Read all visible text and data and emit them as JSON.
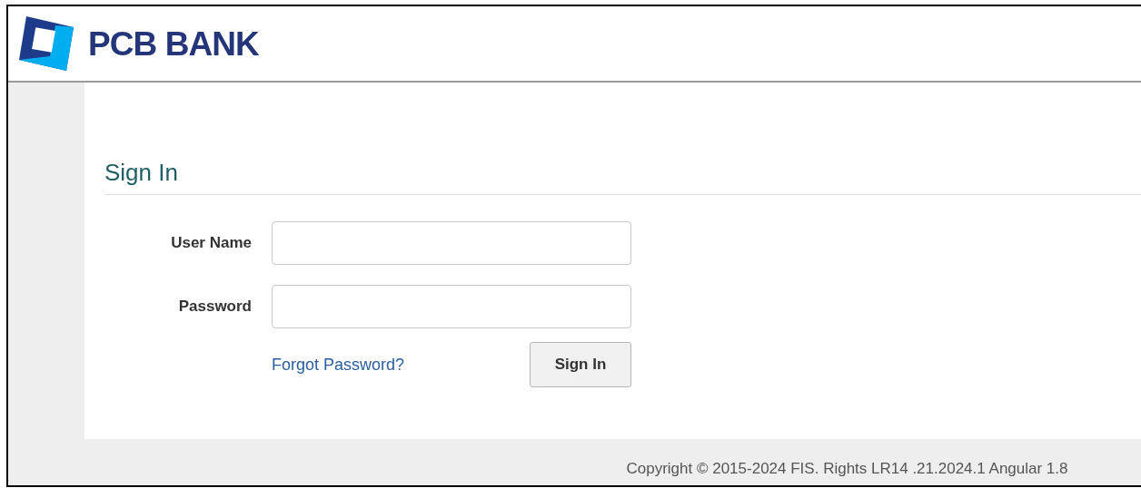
{
  "header": {
    "logo_text": "PCB BANK"
  },
  "form": {
    "title": "Sign In",
    "fields": [
      {
        "label": "User Name"
      },
      {
        "label": "Password"
      }
    ],
    "forgot_link": "Forgot Password?",
    "submit_button": "Sign In"
  },
  "footer": {
    "copyright": "Copyright © 2015-2024 FIS. Rights LR14 .21.2024.1 Angular 1.8"
  }
}
